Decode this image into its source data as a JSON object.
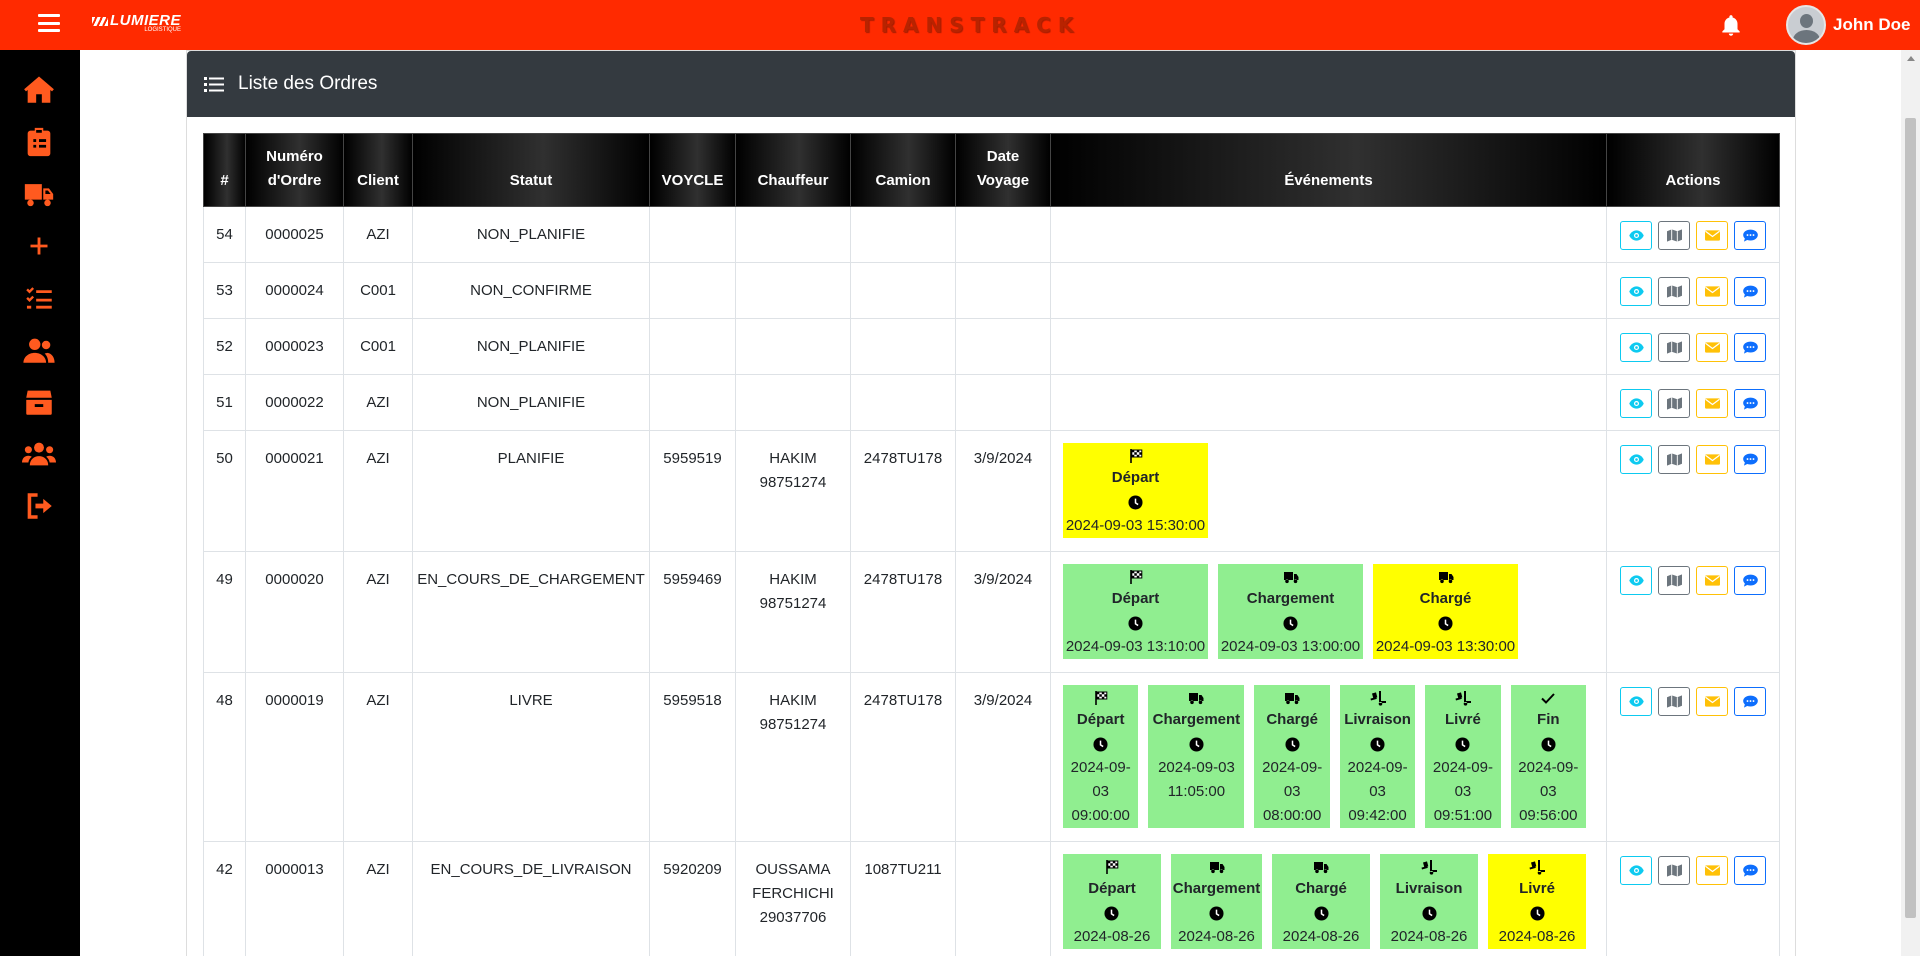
{
  "app": {
    "brand": "TRANSTRACK",
    "logo_text": "LUMIERE",
    "logo_sub": "LOGISTIQUE",
    "user_name": "John Doe"
  },
  "colors": {
    "topbar": "#ff2a00",
    "sidebar_icon": "#ff5a1f",
    "event_done": "#90ee90",
    "event_current": "#ffff00"
  },
  "sidebar": {
    "items": [
      {
        "icon": "home-icon"
      },
      {
        "icon": "clipboard-icon"
      },
      {
        "icon": "truck-icon"
      },
      {
        "icon": "plus-icon"
      },
      {
        "icon": "list-check-icon"
      },
      {
        "icon": "users-icon"
      },
      {
        "icon": "box-icon"
      },
      {
        "icon": "people-group-icon"
      },
      {
        "icon": "logout-icon"
      }
    ]
  },
  "card": {
    "title": "Liste des Ordres"
  },
  "table": {
    "headers": {
      "num": "#",
      "numero": [
        "Numéro",
        "d'Ordre"
      ],
      "client": "Client",
      "statut": "Statut",
      "voycle": "VOYCLE",
      "chauffeur": "Chauffeur",
      "camion": "Camion",
      "date": [
        "Date",
        "Voyage"
      ],
      "evenements": "Événements",
      "actions": "Actions"
    },
    "rows": [
      {
        "id": "54",
        "numero": "0000025",
        "client": "AZI",
        "statut": "NON_PLANIFIE",
        "voycle": "",
        "chauffeur": [
          "",
          ""
        ],
        "camion": "",
        "date": ""
      },
      {
        "id": "53",
        "numero": "0000024",
        "client": "C001",
        "statut": "NON_CONFIRME",
        "voycle": "",
        "chauffeur": [
          "",
          ""
        ],
        "camion": "",
        "date": ""
      },
      {
        "id": "52",
        "numero": "0000023",
        "client": "C001",
        "statut": "NON_PLANIFIE",
        "voycle": "",
        "chauffeur": [
          "",
          ""
        ],
        "camion": "",
        "date": ""
      },
      {
        "id": "51",
        "numero": "0000022",
        "client": "AZI",
        "statut": "NON_PLANIFIE",
        "voycle": "",
        "chauffeur": [
          "",
          ""
        ],
        "camion": "",
        "date": ""
      },
      {
        "id": "50",
        "numero": "0000021",
        "client": "AZI",
        "statut": "PLANIFIE",
        "voycle": "5959519",
        "chauffeur": [
          "HAKIM",
          "98751274"
        ],
        "camion": "2478TU178",
        "date": "3/9/2024",
        "events": [
          {
            "label": "Départ",
            "time": "2024-09-03 15:30:00",
            "state": "current",
            "icon": "flag-icon"
          }
        ]
      },
      {
        "id": "49",
        "numero": "0000020",
        "client": "AZI",
        "statut": "EN_COURS_DE_CHARGEMENT",
        "voycle": "5959469",
        "chauffeur": [
          "HAKIM",
          "98751274"
        ],
        "camion": "2478TU178",
        "date": "3/9/2024",
        "events": [
          {
            "label": "Départ",
            "time": "2024-09-03 13:10:00",
            "state": "done",
            "icon": "flag-icon"
          },
          {
            "label": "Chargement",
            "time": "2024-09-03 13:00:00",
            "state": "done",
            "icon": "truck-icon"
          },
          {
            "label": "Chargé",
            "time": "2024-09-03 13:30:00",
            "state": "current",
            "icon": "truck-icon"
          }
        ]
      },
      {
        "id": "48",
        "numero": "0000019",
        "client": "AZI",
        "statut": "LIVRE",
        "voycle": "5959518",
        "chauffeur": [
          "HAKIM",
          "98751274"
        ],
        "camion": "2478TU178",
        "date": "3/9/2024",
        "events": [
          {
            "label": "Départ",
            "time": "2024-09-03 09:00:00",
            "state": "done",
            "icon": "flag-icon"
          },
          {
            "label": "Chargement",
            "time": "2024-09-03 11:05:00",
            "state": "done",
            "icon": "truck-icon"
          },
          {
            "label": "Chargé",
            "time": "2024-09-03 08:00:00",
            "state": "done",
            "icon": "truck-icon"
          },
          {
            "label": "Livraison",
            "time": "2024-09-03 09:42:00",
            "state": "done",
            "icon": "truck-ramp-icon"
          },
          {
            "label": "Livré",
            "time": "2024-09-03 09:51:00",
            "state": "done",
            "icon": "truck-ramp-icon"
          },
          {
            "label": "Fin",
            "time": "2024-09-03 09:56:00",
            "state": "done",
            "icon": "check-icon"
          }
        ]
      },
      {
        "id": "42",
        "numero": "0000013",
        "client": "AZI",
        "statut": "EN_COURS_DE_LIVRAISON",
        "voycle": "5920209",
        "chauffeur": [
          "OUSSAMA",
          "FERCHICHI",
          "29037706"
        ],
        "camion": "1087TU211",
        "date": "",
        "events": [
          {
            "label": "Départ",
            "time": "2024-08-26",
            "state": "done",
            "icon": "flag-icon"
          },
          {
            "label": "Chargement",
            "time": "2024-08-26",
            "state": "done",
            "icon": "truck-icon"
          },
          {
            "label": "Chargé",
            "time": "2024-08-26",
            "state": "done",
            "icon": "truck-icon"
          },
          {
            "label": "Livraison",
            "time": "2024-08-26",
            "state": "done",
            "icon": "truck-ramp-icon"
          },
          {
            "label": "Livré",
            "time": "2024-08-26",
            "state": "current",
            "icon": "truck-ramp-icon"
          }
        ]
      }
    ],
    "action_buttons": [
      {
        "name": "view-button",
        "icon": "eye-icon"
      },
      {
        "name": "map-button",
        "icon": "map-icon"
      },
      {
        "name": "email-button",
        "icon": "envelope-icon"
      },
      {
        "name": "message-button",
        "icon": "comment-icon"
      }
    ]
  }
}
